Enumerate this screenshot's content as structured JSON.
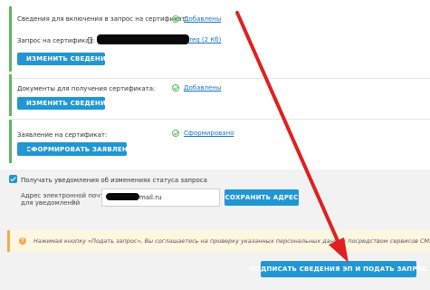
{
  "cert_request": {
    "label": "Сведения для включения в запрос на сертификат:",
    "status": "Добавлены",
    "file_label": "Запрос на сертификат:",
    "file_name": ".req (2 Кб)",
    "edit_button": "ИЗМЕНИТЬ СВЕДЕНИЯ"
  },
  "documents": {
    "label": "Документы для получения сертификата:",
    "status": "Добавлены",
    "edit_button": "ИЗМЕНИТЬ СВЕДЕНИЯ"
  },
  "application": {
    "label": "Заявление на сертификат:",
    "status": "Сформировано",
    "form_button": "СФОРМИРОВАТЬ ЗАЯВЛЕНИЕ"
  },
  "notifications": {
    "checkbox_label": "Получать уведомления об изменениях статуса запроса",
    "checked": true,
    "email_label_line1": "Адрес электронной почты",
    "email_label_line2": "для уведомлений",
    "required_mark": "*",
    "email_value": "@mail.ru",
    "save_button": "СОХРАНИТЬ АДРЕС"
  },
  "notice": {
    "icon": "!",
    "text": "Нажимая кнопку «Подать запрос», Вы соглашаетесь на проверку указанных персональных данных посредством сервисов СМЭВ."
  },
  "submit_button": "ПОДПИСАТЬ СВЕДЕНИЯ ЭП И ПОДАТЬ ЗАПРОС",
  "colors": {
    "accent": "#2196d3",
    "success": "#5cb85c",
    "warning": "#f0ad4e",
    "annotation_arrow": "#e02020"
  }
}
